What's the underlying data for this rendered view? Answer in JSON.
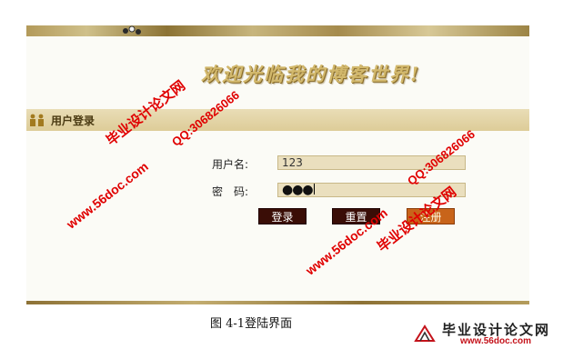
{
  "page": {
    "welcome_title": "欢迎光临我的博客世界!",
    "section_title": "用户登录",
    "caption": "图 4-1登陆界面"
  },
  "form": {
    "username_label": "用户名:",
    "username_value": "123",
    "password_label": "密　码:",
    "password_mask": "●●●",
    "login_label": "登录",
    "reset_label": "重置",
    "register_label": "注册"
  },
  "watermarks": {
    "site_name": "毕业设计论文网",
    "qq": "QQ:306826066",
    "url": "www.56doc.com"
  },
  "logo": {
    "name": "毕业设计论文网",
    "url": "www.56doc.com"
  },
  "colors": {
    "band": "#b39a5a",
    "section_bar": "#ddcc98",
    "input_bg": "#eadfbe",
    "button_dark": "#3a0d06",
    "button_register": "#c8641a",
    "watermark": "#e00000"
  },
  "icons": [
    "ornament-icon",
    "users-icon",
    "logo-icon"
  ]
}
